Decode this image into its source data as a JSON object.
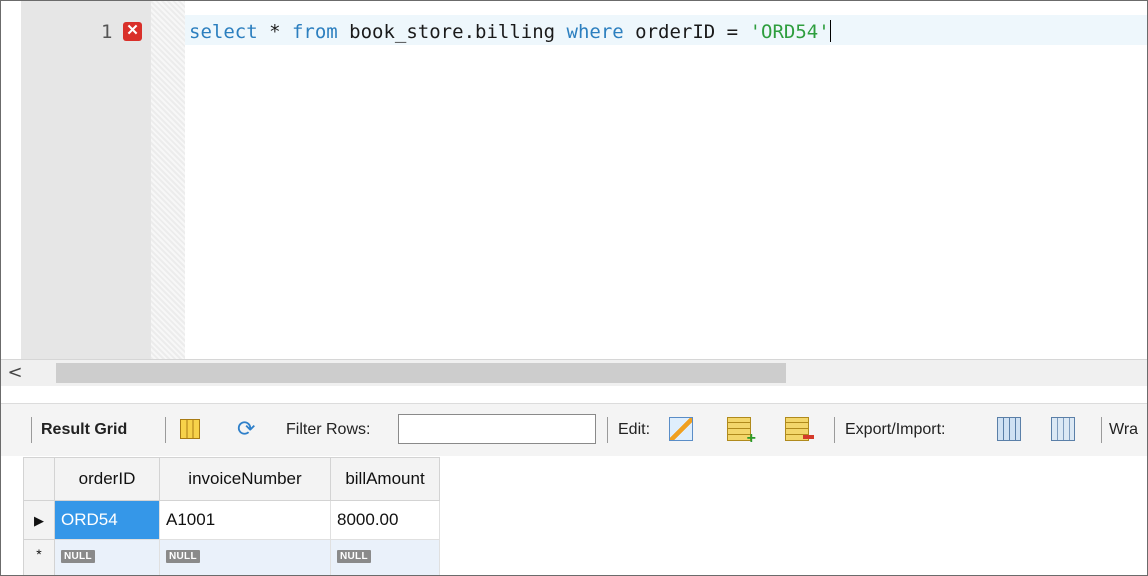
{
  "editor": {
    "line_number": "1",
    "error_marker": "✕",
    "code": {
      "kw_select": "select",
      "t1": " * ",
      "kw_from": "from",
      "t2": " book_store.billing ",
      "kw_where": "where",
      "t3": " orderID = ",
      "str_value": "'ORD54'"
    }
  },
  "scrollbar": {
    "left_arrow": "<"
  },
  "toolbar": {
    "result_grid_label": "Result Grid",
    "filter_rows_label": "Filter Rows:",
    "filter_value": "",
    "edit_label": "Edit:",
    "export_import_label": "Export/Import:",
    "wrap_label": "Wra"
  },
  "grid": {
    "columns": [
      "orderID",
      "invoiceNumber",
      "billAmount"
    ],
    "rows": [
      {
        "marker": "▶",
        "cells": [
          "ORD54",
          "A1001",
          "8000.00"
        ]
      }
    ],
    "new_row": {
      "marker": "*",
      "cells": [
        "NULL",
        "NULL",
        "NULL"
      ]
    }
  },
  "colors": {
    "keyword": "#2c7fbf",
    "string": "#2e9e3e",
    "selection": "#3597e8",
    "error": "#d9302a"
  }
}
